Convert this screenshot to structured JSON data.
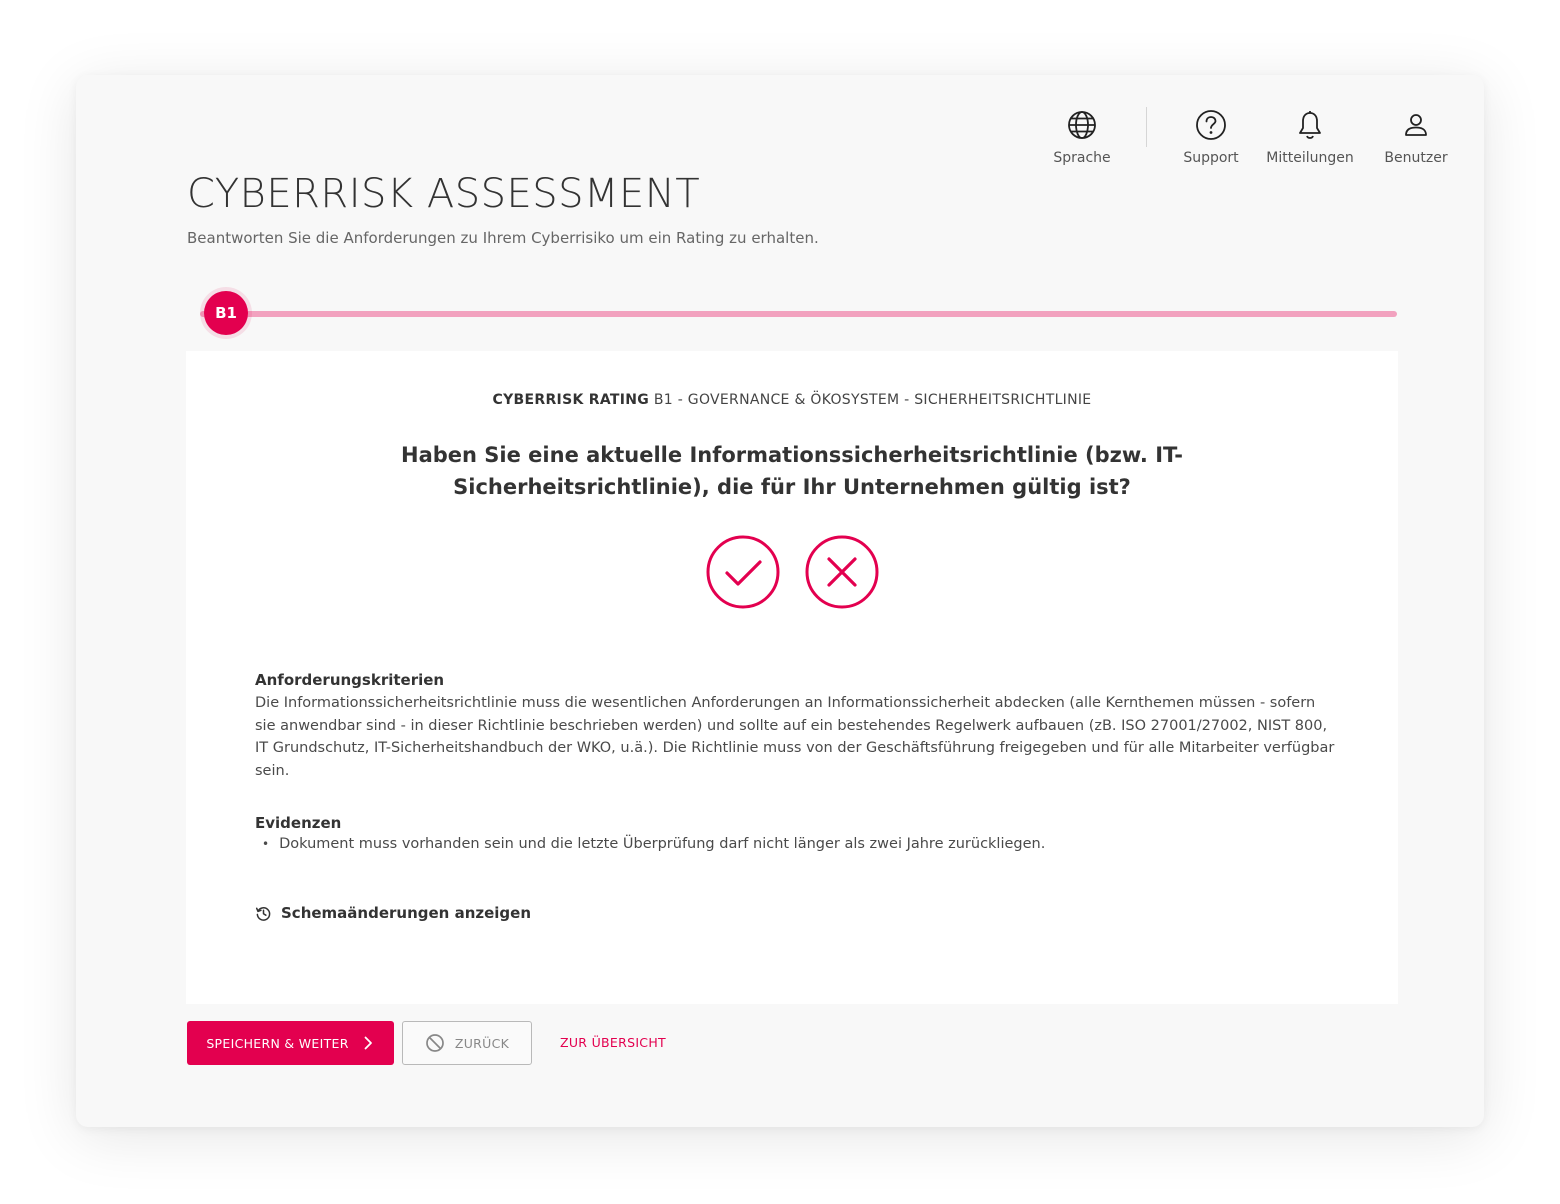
{
  "nav": {
    "language": {
      "label": "Sprache",
      "icon": "globe-icon"
    },
    "support": {
      "label": "Support",
      "icon": "help-circle-icon"
    },
    "notifications": {
      "label": "Mitteilungen",
      "icon": "bell-icon"
    },
    "user": {
      "label": "Benutzer",
      "icon": "user-icon"
    }
  },
  "header": {
    "title": "CYBERRISK ASSESSMENT",
    "subtitle": "Beantworten Sie die Anforderungen zu Ihrem Cyberrisiko um ein Rating zu erhalten."
  },
  "progress": {
    "current_step": "B1"
  },
  "question_card": {
    "category_bold": "CYBERRISK RATING",
    "category_rest": " B1 - GOVERNANCE & ÖKOSYSTEM - SICHERHEITSRICHTLINIE",
    "question": "Haben Sie eine aktuelle Informationssicherheitsrichtlinie (bzw. IT-Sicherheitsrichtlinie), die für Ihr Unternehmen gültig ist?",
    "yes_icon": "check-circle-icon",
    "no_icon": "x-circle-icon",
    "criteria_heading": "Anforderungskriterien",
    "criteria_text": "Die Informationssicherheitsrichtlinie muss die wesentlichen Anforderungen an Informationssicherheit abdecken (alle Kernthemen müssen - sofern sie anwendbar sind - in dieser Richtlinie beschrieben werden) und sollte auf ein bestehendes Regelwerk aufbauen (zB. ISO 27001/27002, NIST 800, IT Grundschutz, IT-Sicherheitshandbuch der WKO, u.ä.). Die Richtlinie muss von der Geschäftsführung freigegeben und für alle Mitarbeiter verfügbar sein.",
    "evidence_heading": "Evidenzen",
    "evidence_items": [
      "Dokument muss vorhanden sein und die letzte Überprüfung darf nicht länger als zwei Jahre zurückliegen."
    ],
    "schema_link": "Schemaänderungen anzeigen"
  },
  "actions": {
    "save_next": "SPEICHERN & WEITER",
    "back": "ZURÜCK",
    "overview": "ZUR ÜBERSICHT"
  },
  "colors": {
    "accent": "#e3004f",
    "progress_track": "#f2a2bf",
    "background": "#f8f8f8"
  }
}
